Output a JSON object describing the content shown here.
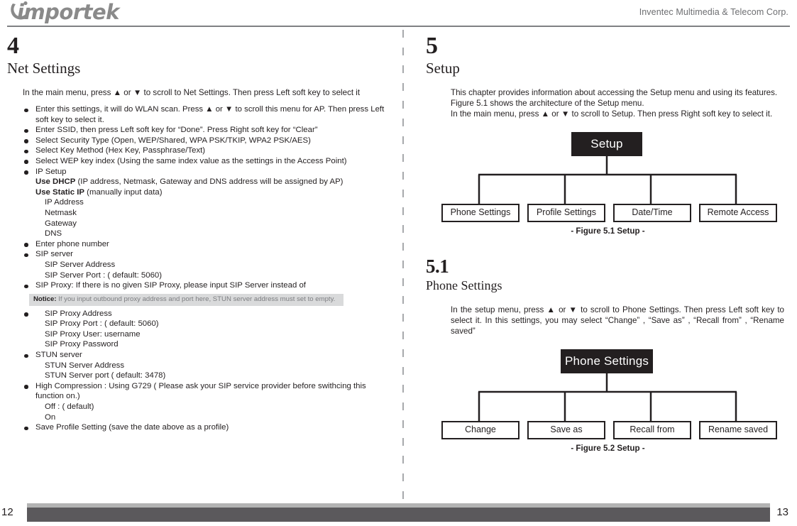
{
  "header": {
    "logo_text": "importek",
    "company": "Inventec Multimedia & Telecom Corp."
  },
  "left_page": {
    "chapter_number": "4",
    "chapter_title": "Net Settings",
    "intro": "In the main menu, press ▲ or ▼ to scroll to Net Settings. Then press Left soft key to select it",
    "bullets": [
      {
        "text": "Enter this settings, it will do WLAN scan. Press ▲ or ▼ to scroll this menu for AP. Then press Left soft key to select it."
      },
      {
        "text": "Enter SSID, then press Left soft key for “Done”. Press Right soft key for “Clear”"
      },
      {
        "text": "Select Security Type (Open, WEP/Shared, WPA PSK/TKIP, WPA2 PSK/AES)"
      },
      {
        "text": "Select Key Method (Hex Key, Passphrase/Text)"
      },
      {
        "text": "Select WEP key index (Using the same index value as the settings in the Access Point)"
      },
      {
        "text": "IP Setup",
        "sub": [
          {
            "bold": "Use DHCP",
            "rest": " (IP address, Netmask, Gateway and DNS address will be assigned by AP)",
            "indent": 1
          },
          {
            "bold": "Use Static IP",
            "rest": " (manually input data)",
            "indent": 1
          },
          {
            "bold": "",
            "rest": "IP Address",
            "indent": 2
          },
          {
            "bold": "",
            "rest": "Netmask",
            "indent": 2
          },
          {
            "bold": "",
            "rest": "Gateway",
            "indent": 2
          },
          {
            "bold": "",
            "rest": "DNS",
            "indent": 2
          }
        ]
      },
      {
        "text": "Enter phone number"
      },
      {
        "text": "SIP server",
        "sub": [
          {
            "bold": "",
            "rest": "SIP Server Address",
            "indent": 2
          },
          {
            "bold": "",
            "rest": "SIP Server Port : ( default: 5060)",
            "indent": 2
          }
        ]
      },
      {
        "text": "SIP Proxy: If there is no given SIP Proxy, please input SIP Server instead of"
      }
    ],
    "notice": {
      "label": "Notice:",
      "text": " If you input outbound proxy address and port here, STUN server address must set to empty."
    },
    "after_notice": [
      "SIP Proxy Address",
      "SIP Proxy Port : ( default: 5060)",
      "SIP Proxy User: username",
      "SIP Proxy Password"
    ],
    "bullets2": [
      {
        "text": "STUN server",
        "sub": [
          {
            "bold": "",
            "rest": "STUN Server Address",
            "indent": 2
          },
          {
            "bold": "",
            "rest": "STUN Server port ( default: 3478)",
            "indent": 2
          }
        ]
      },
      {
        "text": "High Compression : Using G729 ( Please ask your SIP service provider before swithcing this function on.)",
        "sub": [
          {
            "bold": "",
            "rest": "Off : ( default)",
            "indent": 2
          },
          {
            "bold": "",
            "rest": "On",
            "indent": 2
          }
        ]
      },
      {
        "text": "Save Profile Setting (save the date above as a profile)"
      }
    ],
    "page_number": "12"
  },
  "right_page": {
    "chapter_number": "5",
    "chapter_title": "Setup",
    "intro_lines": [
      "This chapter provides information about accessing the Setup menu and using its features.",
      "Figure 5.1 shows the architecture of the Setup menu.",
      "In the main menu, press ▲ or ▼ to scroll to Setup. Then press Right soft key to select it."
    ],
    "figure1": {
      "root": "Setup",
      "leaves": [
        "Phone Settings",
        "Profile Settings",
        "Date/Time",
        "Remote Access"
      ],
      "caption": "- Figure 5.1 Setup -"
    },
    "section_number": "5.1",
    "section_title": "Phone Settings",
    "section_intro": "In the setup menu, press ▲ or ▼ to scroll to Phone Settings. Then press Left soft key to select it. In this settings, you may select “Change” , “Save as” , “Recall from” , “Rename saved”",
    "figure2": {
      "root": "Phone Settings",
      "leaves": [
        "Change",
        "Save as",
        "Recall from",
        "Rename saved"
      ],
      "caption": "- Figure 5.2 Setup -"
    },
    "page_number": "13"
  },
  "colors": {
    "ink": "#231f20",
    "logo_gray": "#8a8a8a",
    "rule_gray": "#808184",
    "notice_bg": "#d9dadb",
    "footer_light": "#b3b3b3",
    "footer_dark": "#5b595c"
  }
}
